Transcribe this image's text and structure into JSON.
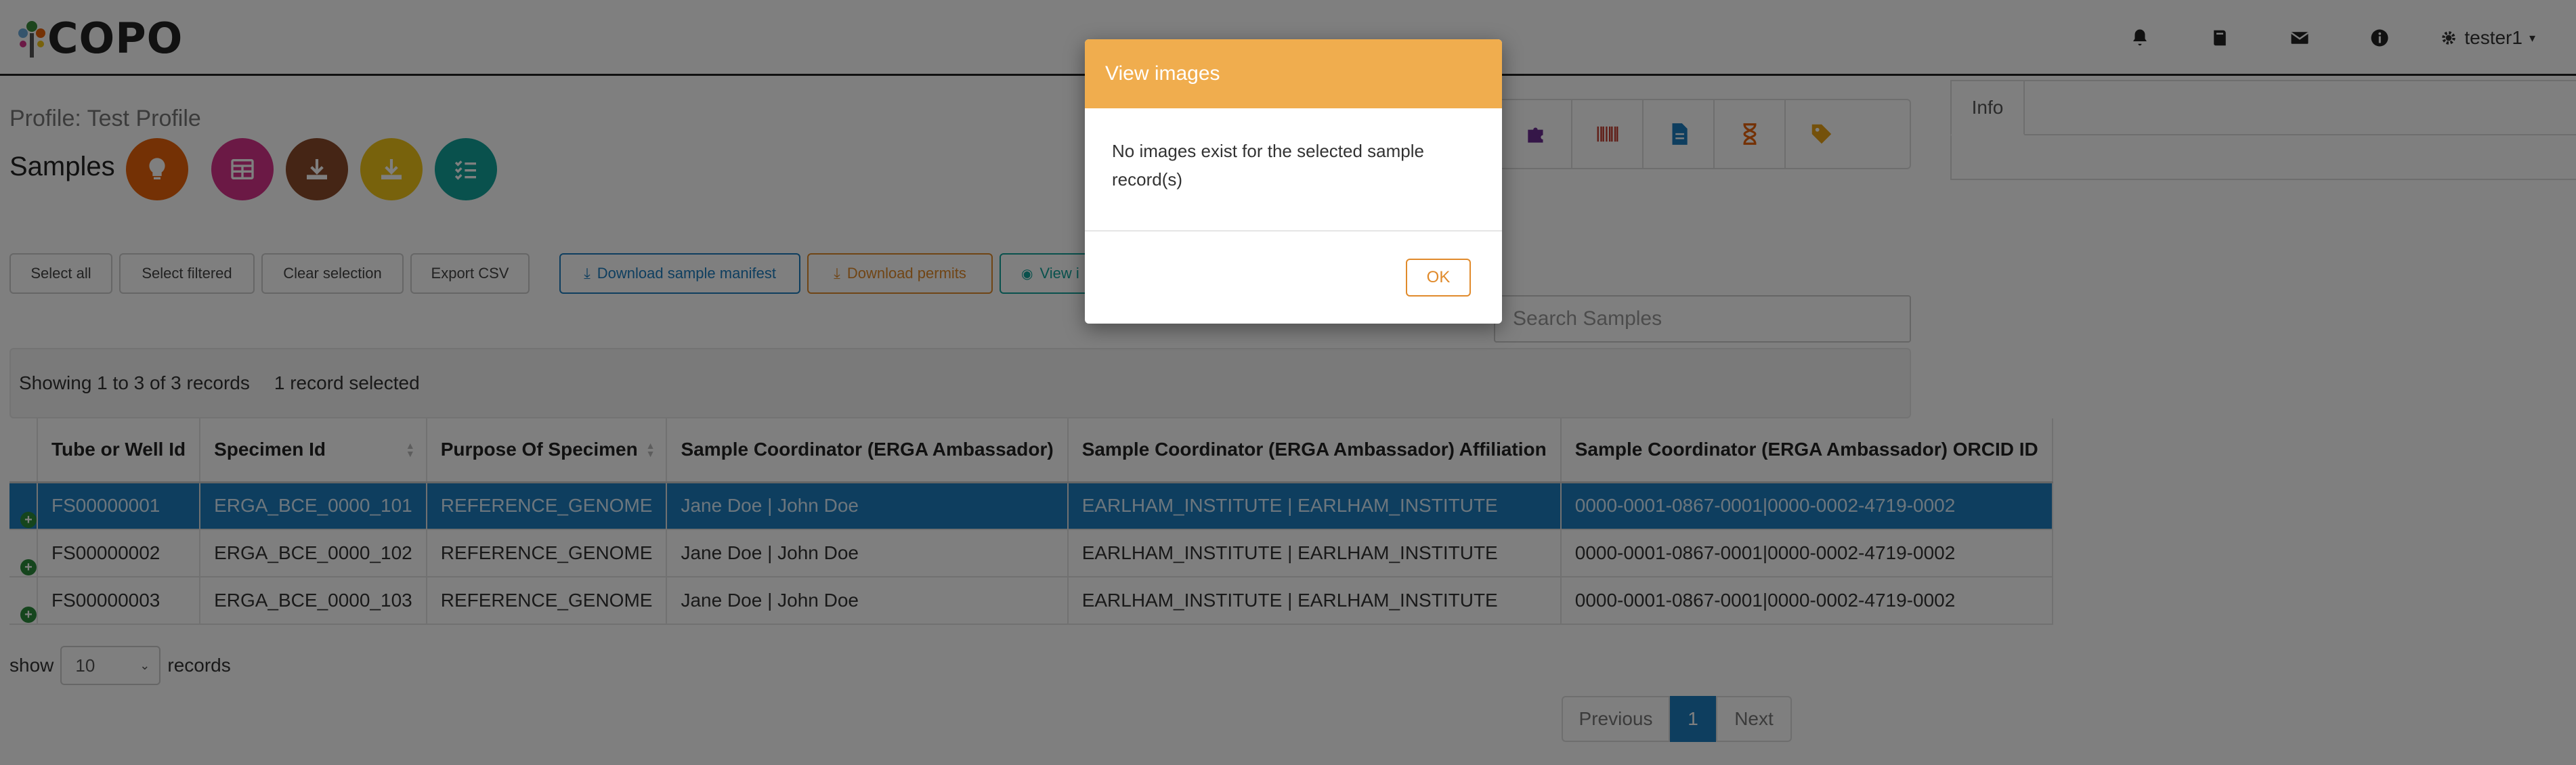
{
  "navbar": {
    "logo_text": "COPO",
    "icons": [
      "bell-icon",
      "book-icon",
      "envelope-icon",
      "info-icon"
    ],
    "user_label": "tester1"
  },
  "profile": {
    "title": "Profile: Test Profile",
    "page_title": "Samples",
    "action_buttons": [
      {
        "name": "lightbulb-icon",
        "color": "#e8630a"
      },
      {
        "name": "table-icon",
        "color": "#d6338a"
      },
      {
        "name": "download-icon",
        "color": "#8b4a2b"
      },
      {
        "name": "download-icon",
        "color": "#f0c419"
      },
      {
        "name": "checklist-icon",
        "color": "#12a39a"
      }
    ]
  },
  "toolbar": {
    "select_all": "Select all",
    "select_filtered": "Select filtered",
    "clear_selection": "Clear selection",
    "export_csv": "Export CSV",
    "download_manifest": "Download sample manifest",
    "download_permits": "Download permits",
    "view_images_partial": "View i"
  },
  "colors": {
    "primary": "#1c7dbf",
    "warning": "#f0ad4e",
    "permit": "#e08a2b",
    "teal": "#12a39a"
  },
  "search": {
    "placeholder": "Search Samples"
  },
  "info_bar": {
    "showing": "Showing 1 to 3 of 3 records",
    "selected": "1 record selected"
  },
  "table": {
    "headers": [
      "Tube or Well Id",
      "Specimen Id",
      "Purpose Of Specimen",
      "Sample Coordinator (ERGA Ambassador)",
      "Sample Coordinator (ERGA Ambassador) Affiliation",
      "Sample Coordinator (ERGA Ambassador) ORCID ID"
    ],
    "rows": [
      {
        "selected": true,
        "cells": [
          "FS00000001",
          "ERGA_BCE_0000_101",
          "REFERENCE_GENOME",
          "Jane Doe | John Doe",
          "EARLHAM_INSTITUTE | EARLHAM_INSTITUTE",
          "0000-0001-0867-0001|0000-0002-4719-0002"
        ]
      },
      {
        "selected": false,
        "cells": [
          "FS00000002",
          "ERGA_BCE_0000_102",
          "REFERENCE_GENOME",
          "Jane Doe | John Doe",
          "EARLHAM_INSTITUTE | EARLHAM_INSTITUTE",
          "0000-0001-0867-0001|0000-0002-4719-0002"
        ]
      },
      {
        "selected": false,
        "cells": [
          "FS00000003",
          "ERGA_BCE_0000_103",
          "REFERENCE_GENOME",
          "Jane Doe | John Doe",
          "EARLHAM_INSTITUTE | EARLHAM_INSTITUTE",
          "0000-0001-0867-0001|0000-0002-4719-0002"
        ]
      }
    ]
  },
  "paging": {
    "show_label": "show",
    "page_size": "10",
    "records_label": "records",
    "previous": "Previous",
    "current_page": "1",
    "next": "Next"
  },
  "info_panel": {
    "tab_label": "Info"
  },
  "modal": {
    "title": "View images",
    "body": "No images exist for the selected sample record(s)",
    "ok_label": "OK"
  }
}
